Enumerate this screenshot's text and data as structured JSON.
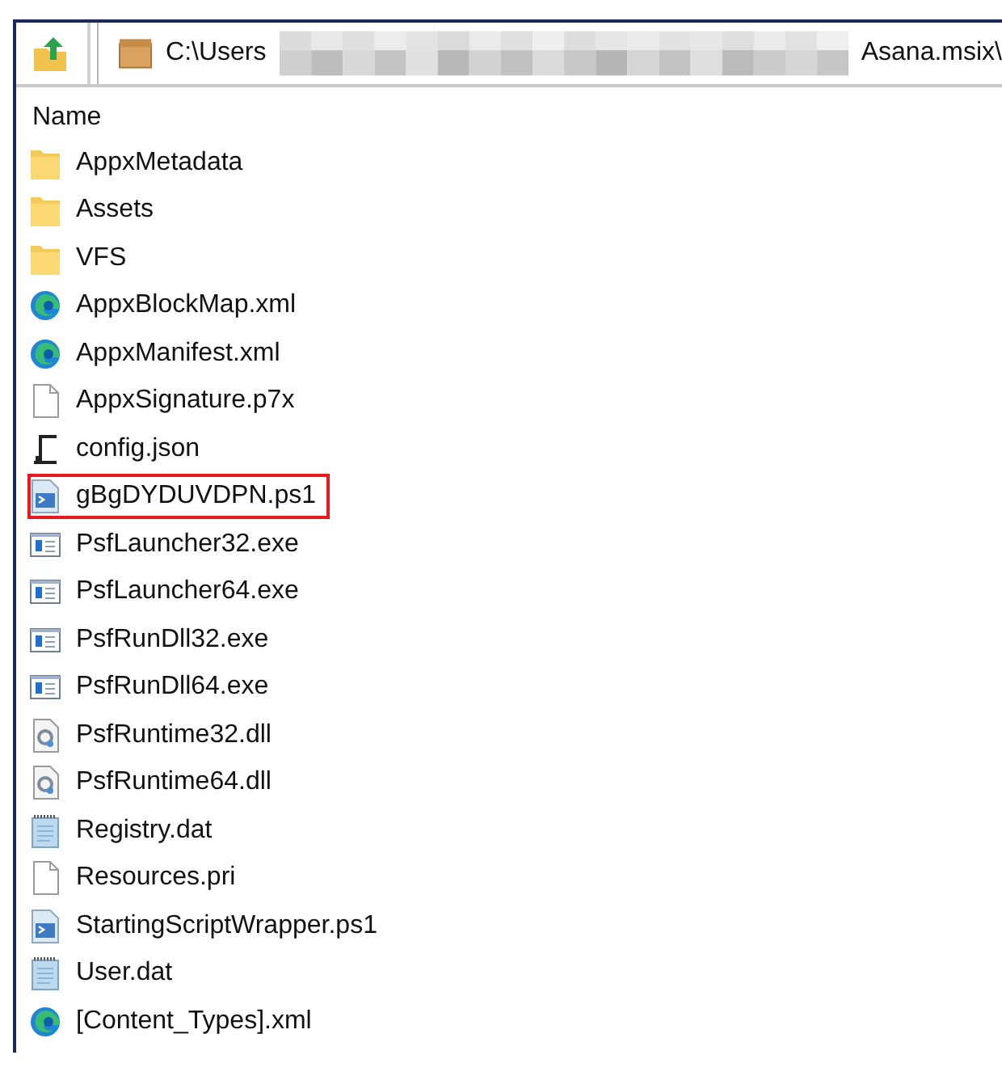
{
  "address": {
    "prefix": "C:\\Users",
    "redacted": true,
    "suffix": "Asana.msix\\"
  },
  "column_header": "Name",
  "files": [
    {
      "name": "AppxMetadata",
      "kind": "folder",
      "highlighted": false
    },
    {
      "name": "Assets",
      "kind": "folder",
      "highlighted": false
    },
    {
      "name": "VFS",
      "kind": "folder",
      "highlighted": false
    },
    {
      "name": "AppxBlockMap.xml",
      "kind": "edge",
      "highlighted": false
    },
    {
      "name": "AppxManifest.xml",
      "kind": "edge",
      "highlighted": false
    },
    {
      "name": "AppxSignature.p7x",
      "kind": "blank",
      "highlighted": false
    },
    {
      "name": "config.json",
      "kind": "json",
      "highlighted": false
    },
    {
      "name": "gBgDYDUVDPN.ps1",
      "kind": "script",
      "highlighted": true
    },
    {
      "name": "PsfLauncher32.exe",
      "kind": "exe",
      "highlighted": false
    },
    {
      "name": "PsfLauncher64.exe",
      "kind": "exe",
      "highlighted": false
    },
    {
      "name": "PsfRunDll32.exe",
      "kind": "exe",
      "highlighted": false
    },
    {
      "name": "PsfRunDll64.exe",
      "kind": "exe",
      "highlighted": false
    },
    {
      "name": "PsfRuntime32.dll",
      "kind": "dll",
      "highlighted": false
    },
    {
      "name": "PsfRuntime64.dll",
      "kind": "dll",
      "highlighted": false
    },
    {
      "name": "Registry.dat",
      "kind": "notepad",
      "highlighted": false
    },
    {
      "name": "Resources.pri",
      "kind": "blank",
      "highlighted": false
    },
    {
      "name": "StartingScriptWrapper.ps1",
      "kind": "script",
      "highlighted": false
    },
    {
      "name": "User.dat",
      "kind": "notepad",
      "highlighted": false
    },
    {
      "name": "[Content_Types].xml",
      "kind": "edge",
      "highlighted": false
    }
  ]
}
